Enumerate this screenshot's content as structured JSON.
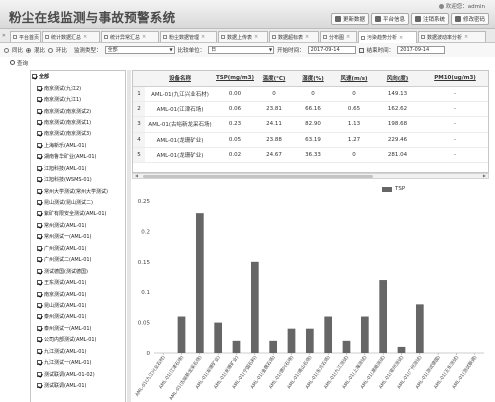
{
  "app": {
    "title": "粉尘在线监测与事故预警系统",
    "welcome": "欢迎您：admin",
    "buttons": [
      {
        "label": "更新数据",
        "icon": "refresh-icon"
      },
      {
        "label": "平台信息",
        "icon": "info-icon"
      },
      {
        "label": "注销系统",
        "icon": "logout-icon"
      },
      {
        "label": "修改密码",
        "icon": "key-icon"
      }
    ]
  },
  "tabs": [
    {
      "label": "平台首页",
      "closable": false
    },
    {
      "label": "统计数据汇总",
      "closable": true
    },
    {
      "label": "统计异常汇总",
      "closable": true
    },
    {
      "label": "粉尘数据管理",
      "closable": true
    },
    {
      "label": "数据上传表",
      "closable": true
    },
    {
      "label": "数据超标表",
      "closable": true
    },
    {
      "label": "分布图",
      "closable": true
    },
    {
      "label": "污染趋势分析",
      "closable": true,
      "active": true
    },
    {
      "label": "数据波动率分析",
      "closable": true
    }
  ],
  "filters": {
    "view_options": [
      "同比",
      "混比",
      "环比"
    ],
    "selected_view": "混比",
    "type_label": "监测类型：",
    "type_value": "全部",
    "compare_label": "比较单位：",
    "compare_value": "日",
    "start_label": "开始时间：",
    "start_value": "2017-09-14",
    "end_label": "结束时间：",
    "end_value": "2017-09-14",
    "query_label": "查询"
  },
  "tree": {
    "root": "全部",
    "items": [
      "南京测试(九江2)",
      "南京测试(九江1)",
      "南京测试(南京测试2)",
      "南京测试(南京测试1)",
      "南京测试(南京测试3)",
      "上海新乐(AML-01)",
      "湖南鲁华矿业(AML-01)",
      "江旭科技(AML-01)",
      "江旭科技(WSMS-01)",
      "常州大学测试(常州大学测试)",
      "昆山测试(昆山测试二)",
      "紫矿有限安全测试(AML-01)",
      "常州测试(AML-01)",
      "常州测试一(AML-01)",
      "广州测试(AML-01)",
      "广州测试二(AML-01)",
      "测试德国(测试德国)",
      "王东测试(AML-01)",
      "南京测试(AML-01)",
      "昆山测试(AML-01)",
      "泰州测试(AML-01)",
      "泰州测试一(AML-01)",
      "公司内部测试(AML-01)",
      "九江测试(AML-01)",
      "九江测试一(AML-01)",
      "测试联调(AML-01-02)",
      "测试联调(AML-01)"
    ]
  },
  "table": {
    "columns": [
      "设备名称",
      "TSP(mg/m3)",
      "温度(°C)",
      "湿度(%)",
      "风速(m/s)",
      "风向(度)",
      "PM10(ug/m3)"
    ],
    "rows": [
      [
        "1",
        "AML-01(九江兴业石材)",
        "0.00",
        "0",
        "0",
        "0",
        "149.13",
        "-"
      ],
      [
        "2",
        "AML-01(江津石场)",
        "0.06",
        "23.81",
        "66.16",
        "0.65",
        "162.62",
        "-"
      ],
      [
        "3",
        "AML-01(古峪新龙采石场)",
        "0.23",
        "24.11",
        "82.90",
        "1.13",
        "198.68",
        "-"
      ],
      [
        "4",
        "AML-01(龙珊矿业)",
        "0.05",
        "23.88",
        "63.19",
        "1.27",
        "229.46",
        "-"
      ],
      [
        "5",
        "AML-01(龙珊矿业)",
        "0.02",
        "24.67",
        "36.33",
        "0",
        "281.04",
        "-"
      ]
    ]
  },
  "chart_data": {
    "type": "bar",
    "categories": [
      "AML-01(九江兴业石材)",
      "AML-01(江津石场)",
      "AML-01(古峪新龙采石场)",
      "AML-01(龙珊矿业)",
      "AML-01(龙珊矿业)",
      "AML-01(宁国石料)",
      "AML-01(金鼎石场)",
      "AML-01(德兴石场)",
      "AML-01(南山石场)",
      "AML-01(东方石场)",
      "AML-01(九江测试)",
      "AML-01(上海测试)",
      "AML-01(湖南测试)",
      "AML-01(常州测试)",
      "AML-01(广州测试)",
      "AML-01(测试德国)",
      "AML-01(王东测试)",
      "AML-01(测试联调)"
    ],
    "series": [
      {
        "name": "TSP",
        "values": [
          0,
          0.06,
          0.23,
          0.05,
          0.02,
          0.15,
          0.02,
          0.04,
          0.04,
          0.06,
          0.02,
          0.06,
          0.12,
          0.01,
          0.08,
          0,
          0,
          0
        ]
      }
    ],
    "ylim": [
      0,
      0.25
    ],
    "yticks": [
      "0.25",
      "0.2",
      "0.15",
      "0.1",
      "0.05",
      "0"
    ],
    "legend_position": "top-right",
    "bar_color": "#666666"
  }
}
